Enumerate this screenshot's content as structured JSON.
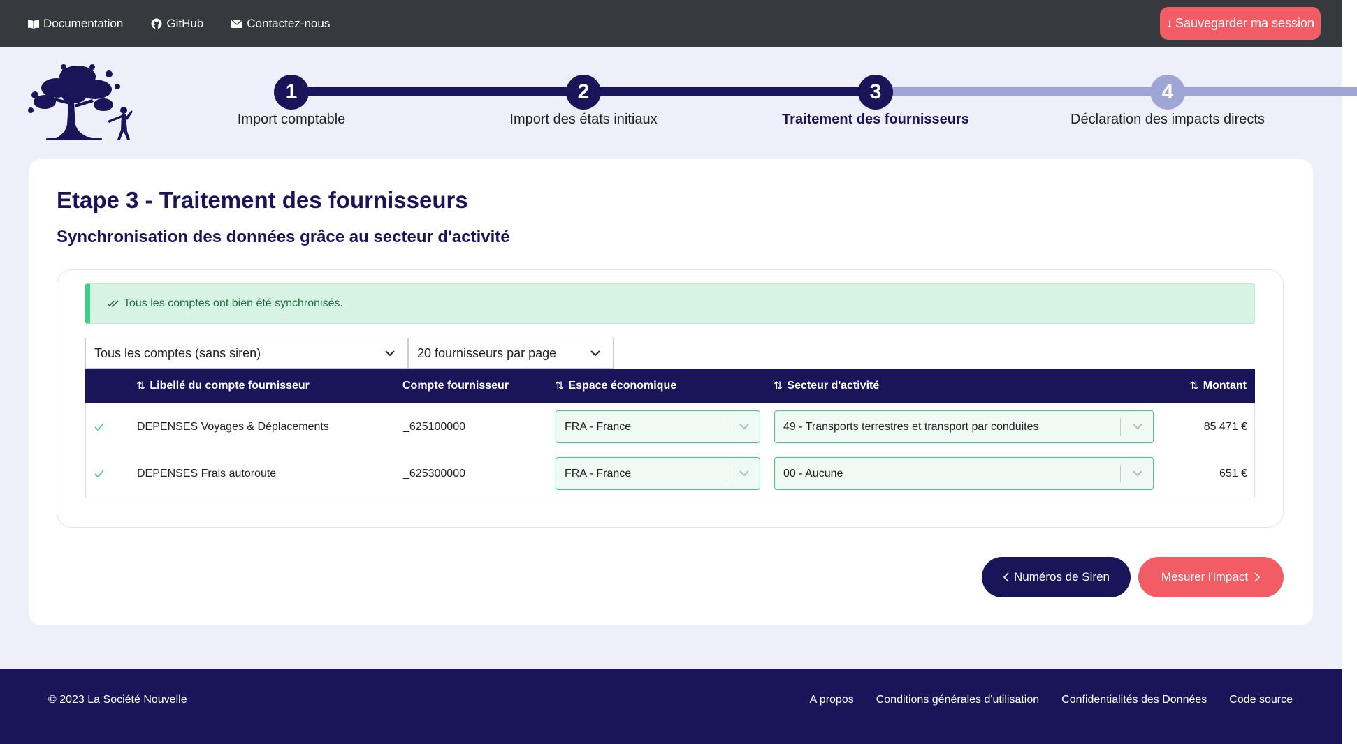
{
  "topbar": {
    "links": [
      {
        "label": "Documentation",
        "icon": "book-icon"
      },
      {
        "label": "GitHub",
        "icon": "github-icon"
      },
      {
        "label": "Contactez-nous",
        "icon": "envelope-icon"
      }
    ],
    "save_label": "Sauvegarder ma session"
  },
  "stepper": {
    "steps": [
      {
        "number": "1",
        "label": "Import comptable",
        "state": "done"
      },
      {
        "number": "2",
        "label": "Import des états initiaux",
        "state": "done"
      },
      {
        "number": "3",
        "label": "Traitement des fournisseurs",
        "state": "active"
      },
      {
        "number": "4",
        "label": "Déclaration des impacts directs",
        "state": "todo"
      }
    ]
  },
  "main": {
    "title": "Etape 3 - Traitement des fournisseurs",
    "subtitle": "Synchronisation des données grâce au secteur d'activité",
    "alert": "Tous les comptes ont bien été synchronisés.",
    "filter_select": "Tous les comptes (sans siren)",
    "per_page_select": "20 fournisseurs par page",
    "table": {
      "headers": {
        "label": "Libellé du compte fournisseur",
        "account": "Compte fournisseur",
        "area": "Espace économique",
        "sector": "Secteur d'activité",
        "amount": "Montant"
      },
      "rows": [
        {
          "label": "DEPENSES Voyages & Déplacements",
          "account": "_625100000",
          "area": "FRA - France",
          "sector": "49 - Transports terrestres et transport par conduites",
          "amount": "85 471 €"
        },
        {
          "label": "DEPENSES Frais autoroute",
          "account": "_625300000",
          "area": "FRA - France",
          "sector": "00 - Aucune",
          "amount": "651 €"
        }
      ]
    },
    "prev_button": "Numéros de Siren",
    "next_button": "Mesurer l'impact"
  },
  "footer": {
    "copyright": "© 2023 La Société Nouvelle",
    "links": [
      "A propos",
      "Conditions générales d'utilisation",
      "Confidentialités des Données",
      "Code source"
    ]
  },
  "colors": {
    "navy": "#191558",
    "coral": "#f25c65",
    "topbar": "#363a3f",
    "green": "#3ecf86",
    "step_inactive": "#9fa5d4",
    "page_bg": "#eeeff9"
  }
}
